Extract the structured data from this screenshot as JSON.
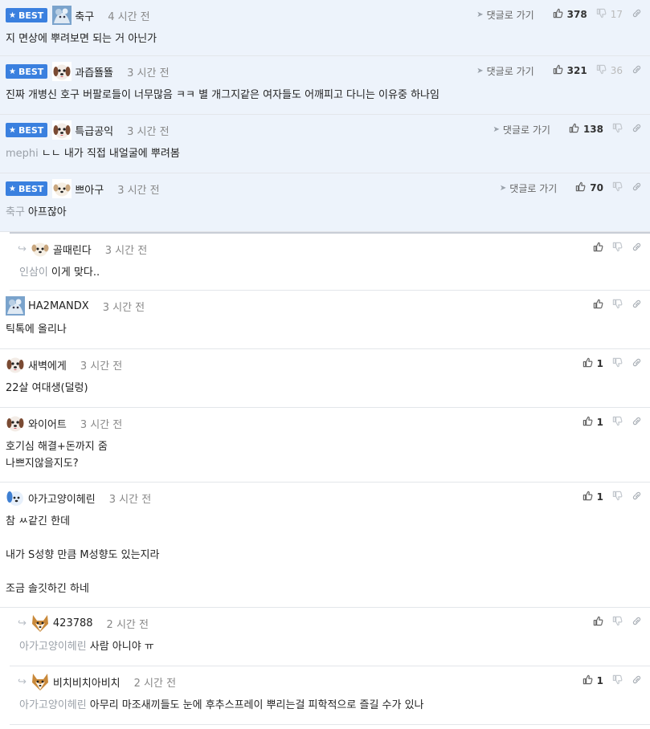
{
  "labels": {
    "best": "BEST",
    "goto_reply": "댓글로 가기"
  },
  "comments": [
    {
      "best": true,
      "avatar": "blue",
      "nick": "축구",
      "time": "4 시간 전",
      "up": "378",
      "down": "17",
      "goto": true,
      "body": [
        {
          "text": "지 면상에 뿌려보면 되는 거 아닌가"
        }
      ]
    },
    {
      "best": true,
      "avatar": "dog",
      "nick": "과즙뚈뚈",
      "time": "3 시간 전",
      "up": "321",
      "down": "36",
      "goto": true,
      "body": [
        {
          "text": "진짜 개병신 호구 버팔로들이 너무많음 ㅋㅋ 별 개그지같은 여자들도 어깨피고 다니는 이유중 하나임"
        }
      ]
    },
    {
      "best": true,
      "avatar": "dog",
      "nick": "특급공익",
      "time": "3 시간 전",
      "up": "138",
      "down": "",
      "goto": true,
      "body": [
        {
          "mention": "mephi",
          "text": "ㄴㄴ 내가 직접 내얼굴에 뿌려봄"
        }
      ]
    },
    {
      "best": true,
      "avatar": "puppy",
      "nick": "쁘아구",
      "time": "3 시간 전",
      "up": "70",
      "down": "",
      "goto": true,
      "body": [
        {
          "mention": "축구",
          "text": "아프잖아"
        }
      ]
    },
    {
      "reply": true,
      "avatar": "puppy",
      "nick": "골때린다",
      "time": "3 시간 전",
      "up": "",
      "down": "",
      "body": [
        {
          "mention": "인삼이",
          "text": "이게 맞다.."
        }
      ]
    },
    {
      "avatar": "blue",
      "nick": "HA2MANDX",
      "time": "3 시간 전",
      "up": "",
      "down": "",
      "body": [
        {
          "text": "틱톡에 올리나"
        }
      ]
    },
    {
      "avatar": "dog",
      "nick": "새벽에게",
      "time": "3 시간 전",
      "up": "1",
      "down": "",
      "body": [
        {
          "text": "22살 여대생(덜렁)"
        }
      ]
    },
    {
      "avatar": "dog",
      "nick": "와이어트",
      "time": "3 시간 전",
      "up": "1",
      "down": "",
      "body": [
        {
          "text": "호기심 해결+돈까지 줌"
        },
        {
          "text": "나쁘지않을지도?"
        }
      ]
    },
    {
      "avatar": "bluepuppy",
      "nick": "아가고양이헤린",
      "time": "3 시간 전",
      "up": "1",
      "down": "",
      "body": [
        {
          "text": "참 ㅆ같긴 한데"
        },
        {
          "text": ""
        },
        {
          "text": "내가 S성향 만큼 M성향도 있는지라"
        },
        {
          "text": ""
        },
        {
          "text": "조금 솔깃하긴 하네"
        }
      ]
    },
    {
      "reply": true,
      "avatar": "fox",
      "nick": "423788",
      "time": "2 시간 전",
      "up": "",
      "down": "",
      "body": [
        {
          "mention": "아가고양이헤린",
          "text": "사람 아니야 ㅠ"
        }
      ]
    },
    {
      "reply": true,
      "avatar": "fox",
      "nick": "비치비치아비치",
      "time": "2 시간 전",
      "up": "1",
      "down": "",
      "body": [
        {
          "mention": "아가고양이헤린",
          "text": "아무리 마조새끼들도 눈에 후추스프레이 뿌리는걸 피학적으로 즐길 수가 있나"
        }
      ]
    }
  ]
}
